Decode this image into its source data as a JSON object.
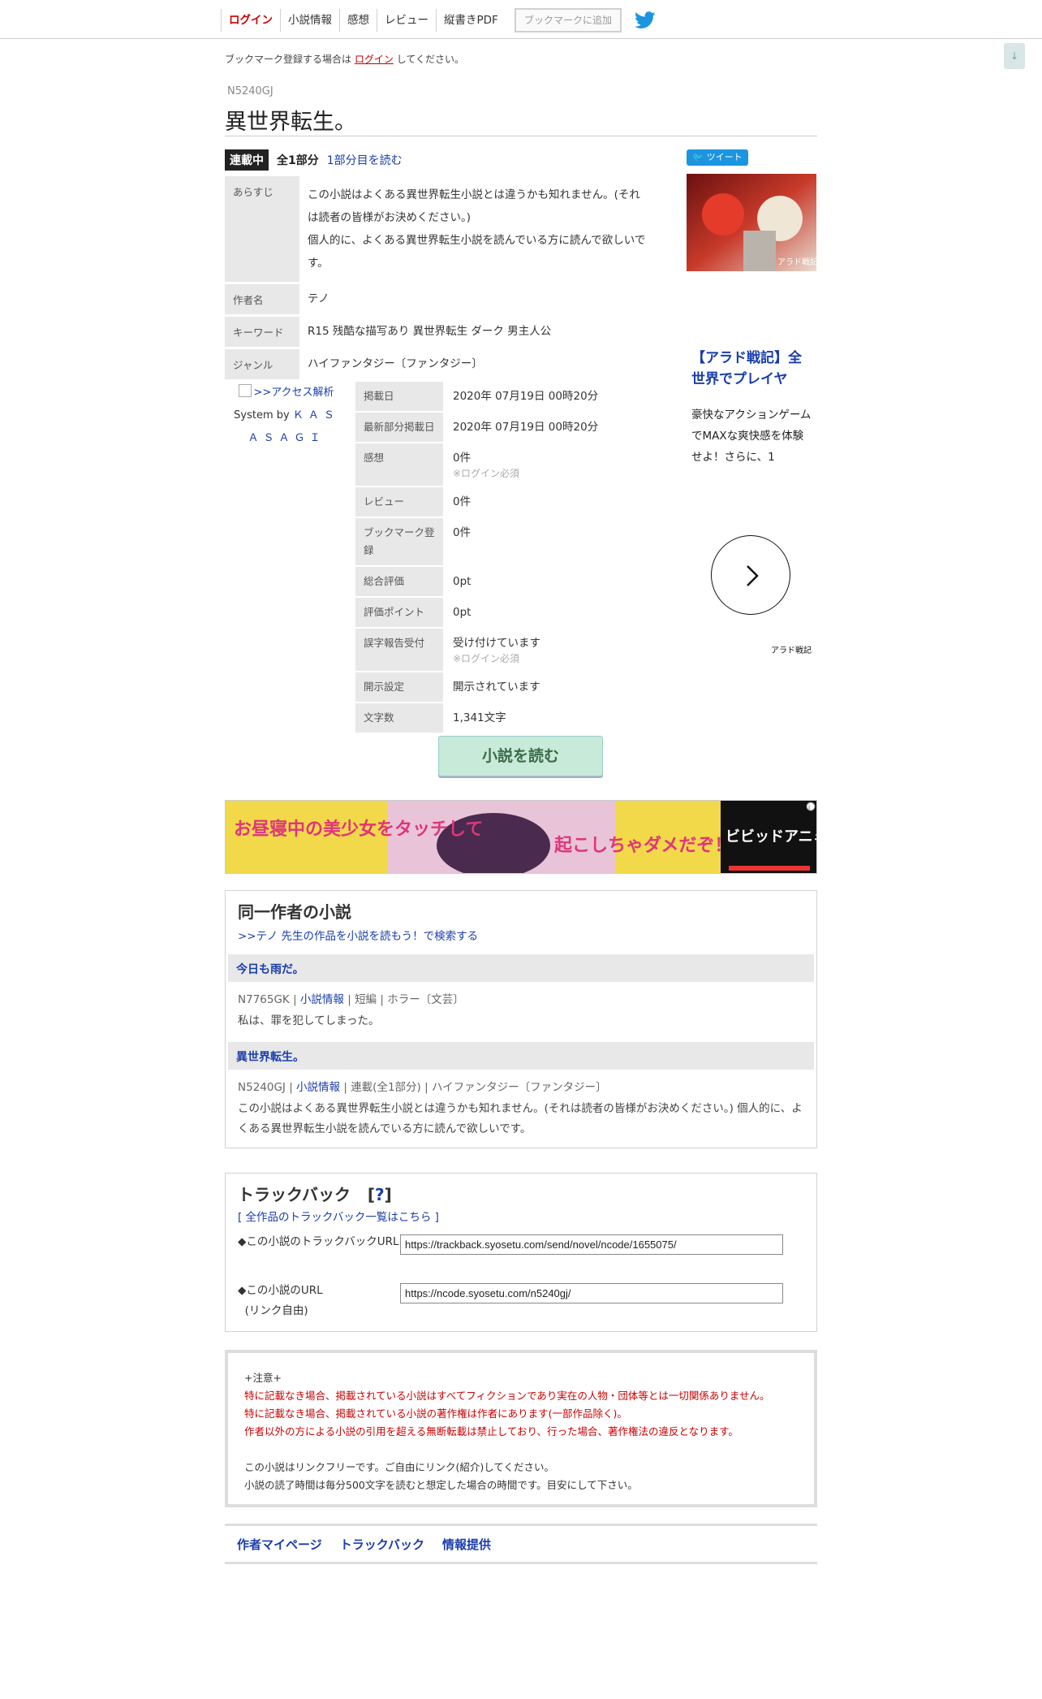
{
  "nav": {
    "items": [
      "ログイン",
      "小説情報",
      "感想",
      "レビュー",
      "縦書きPDF"
    ],
    "bookmark_button": "ブックマークに追加"
  },
  "scroll_down": "↓",
  "notice": {
    "before": "ブックマーク登録する場合は",
    "link": "ログイン",
    "after": "してください。"
  },
  "novel": {
    "ncode": "N5240GJ",
    "title": "異世界転生。",
    "status_badge": "連載中",
    "parts": "全1部分",
    "read_first": "1部分目を読む"
  },
  "info": [
    {
      "label": "あらすじ",
      "value": "この小説はよくある異世界転生小説とは違うかも知れません。(それは読者の皆様がお決めください。)\n個人的に、よくある異世界転生小説を読んでいる方に読んで欲しいです。"
    },
    {
      "label": "作者名",
      "value": "テノ"
    },
    {
      "label": "キーワード",
      "value": "R15 残酷な描写あり 異世界転生 ダーク 男主人公"
    },
    {
      "label": "ジャンル",
      "value": "ハイファンタジー〔ファンタジー〕"
    }
  ],
  "access": {
    "link": ">>アクセス解析",
    "system_by": "System by",
    "system_name": "ＫＡＳＡＳＡＧＩ"
  },
  "stats": [
    {
      "label": "掲載日",
      "value": "2020年 07月19日 00時20分",
      "note": ""
    },
    {
      "label": "最新部分掲載日",
      "value": "2020年 07月19日 00時20分",
      "note": ""
    },
    {
      "label": "感想",
      "value": "0件",
      "note": "※ログイン必須"
    },
    {
      "label": "レビュー",
      "value": "0件",
      "note": ""
    },
    {
      "label": "ブックマーク登録",
      "value": "0件",
      "note": ""
    },
    {
      "label": "総合評価",
      "value": "0pt",
      "note": ""
    },
    {
      "label": "評価ポイント",
      "value": "0pt",
      "note": ""
    },
    {
      "label": "誤字報告受付",
      "value": "受け付けています",
      "note": "※ログイン必須"
    },
    {
      "label": "開示設定",
      "value": "開示されています",
      "note": ""
    },
    {
      "label": "文字数",
      "value": "1,341文字",
      "note": ""
    }
  ],
  "ad": {
    "tweet": "ツイート",
    "headline": "【アラド戦記】全世界でプレイヤ",
    "description": "豪快なアクションゲームでMAXな爽快感を体験せよ！さらに、1",
    "brand": "アラド戦記",
    "image_text": "アラド戦記",
    "banner_left": "お昼寝中の美少女をタッチして",
    "banner_mid": "起こしちゃダメだぞ！",
    "banner_logo": "ビビッドアニミー"
  },
  "read_button": "小説を読む",
  "same_author": {
    "title": "同一作者の小説",
    "search_link": ">>テノ 先生の作品を小説を読もう！で検索する",
    "novels": [
      {
        "title": "今日も雨だ。",
        "ncode": "N7765GK",
        "info_link": "小説情報",
        "type": "短編",
        "genre": "ホラー〔文芸〕",
        "desc": "私は、罪を犯してしまった。"
      },
      {
        "title": "異世界転生。",
        "ncode": "N5240GJ",
        "info_link": "小説情報",
        "type": "連載(全1部分)",
        "genre": "ハイファンタジー〔ファンタジー〕",
        "desc": "この小説はよくある異世界転生小説とは違うかも知れません。(それは読者の皆様がお決めください。) 個人的に、よくある異世界転生小説を読んでいる方に読んで欲しいです。"
      }
    ]
  },
  "trackback": {
    "title": "トラックバック",
    "help": "?",
    "all_link": "[ 全作品のトラックバック一覧はこちら ]",
    "tb_label": "◆この小説のトラックバックURL",
    "tb_url": "https://trackback.syosetu.com/send/novel/ncode/1655075/",
    "url_label": "◆この小説のURL",
    "url_note": "(リンク自由)",
    "novel_url": "https://ncode.syosetu.com/n5240gj/"
  },
  "notes": {
    "head": "+注意+",
    "red": [
      "特に記載なき場合、掲載されている小説はすべてフィクションであり実在の人物・団体等とは一切関係ありません。",
      "特に記載なき場合、掲載されている小説の著作権は作者にあります(一部作品除く)。",
      "作者以外の方による小説の引用を超える無断転載は禁止しており、行った場合、著作権法の違反となります。"
    ],
    "plain": [
      "この小説はリンクフリーです。ご自由にリンク(紹介)してください。",
      "小説の読了時間は毎分500文字を読むと想定した場合の時間です。目安にして下さい。"
    ]
  },
  "footer": [
    "作者マイページ",
    "トラックバック",
    "情報提供"
  ],
  "colors": {
    "accent": "#c00000",
    "link": "#1a3dab",
    "read_button": "#c8ead8",
    "twitter": "#1b95e0"
  }
}
